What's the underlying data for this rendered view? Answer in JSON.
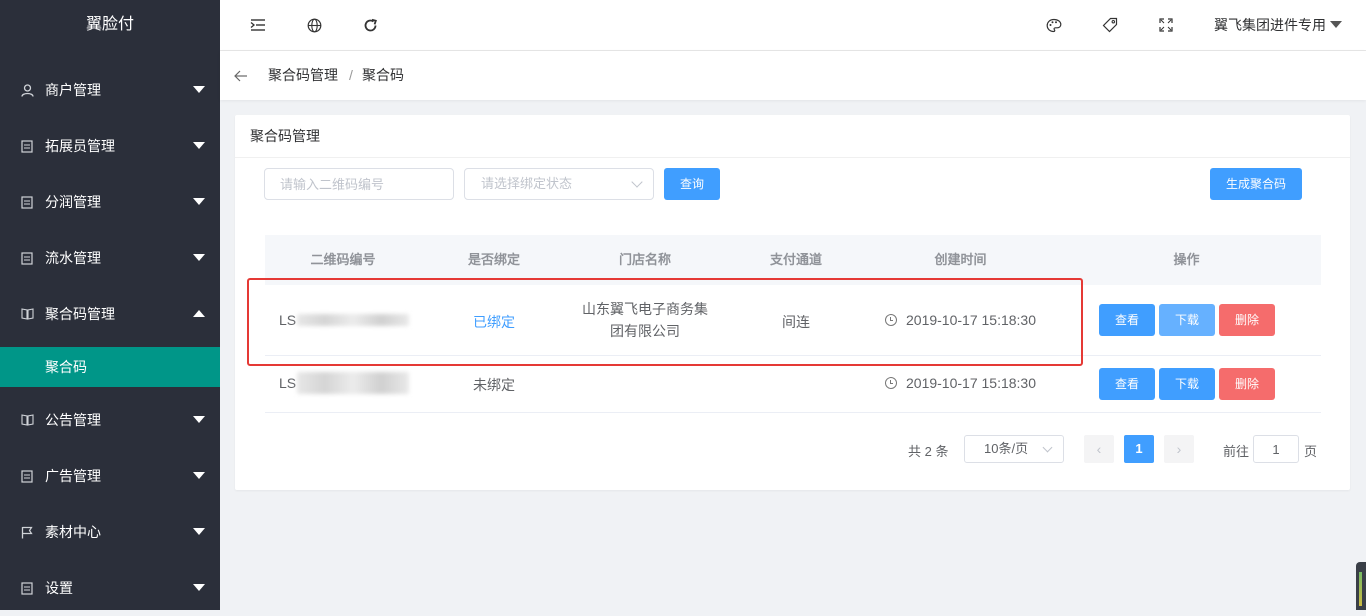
{
  "sidebar": {
    "brand": "翼脸付",
    "items": [
      {
        "label": "商户管理",
        "icon": "user-icon"
      },
      {
        "label": "拓展员管理",
        "icon": "doc-icon"
      },
      {
        "label": "分润管理",
        "icon": "doc-icon"
      },
      {
        "label": "流水管理",
        "icon": "doc-icon"
      },
      {
        "label": "聚合码管理",
        "icon": "book-icon",
        "expanded": true
      },
      {
        "label": "公告管理",
        "icon": "book-icon"
      },
      {
        "label": "广告管理",
        "icon": "doc-icon"
      },
      {
        "label": "素材中心",
        "icon": "flag-icon"
      },
      {
        "label": "设置",
        "icon": "doc-icon"
      }
    ],
    "subitem": "聚合码",
    "active_color": "#009688"
  },
  "topbar": {
    "icons": [
      "menu-fold-icon",
      "globe-icon",
      "refresh-icon",
      "palette-icon",
      "tag-icon",
      "fullscreen-icon"
    ],
    "user": "翼飞集团进件专用"
  },
  "breadcrumb": {
    "parent": "聚合码管理",
    "separator": "/",
    "current": "聚合码"
  },
  "card": {
    "title": "聚合码管理",
    "search_placeholder": "请输入二维码编号",
    "status_placeholder": "请选择绑定状态",
    "query_label": "查询",
    "generate_label": "生成聚合码"
  },
  "table": {
    "headers": [
      "二维码编号",
      "是否绑定",
      "门店名称",
      "支付通道",
      "创建时间",
      "操作"
    ],
    "rows": [
      {
        "code": "LS",
        "bound": "已绑定",
        "store_line1": "山东翼飞电子商务集",
        "store_line2": "团有限公司",
        "channel": "间连",
        "created": "2019-10-17 15:18:30"
      },
      {
        "code": "LS",
        "bound": "未绑定",
        "store_line1": "",
        "store_line2": "",
        "channel": "",
        "created": "2019-10-17 15:18:30"
      }
    ],
    "actions": {
      "view": "查看",
      "download": "下载",
      "delete": "删除"
    }
  },
  "pagination": {
    "total": "共 2 条",
    "page_size": "10条/页",
    "prev": "‹",
    "current": "1",
    "next": "›",
    "goto_label": "前往",
    "goto_value": "1",
    "page_unit": "页"
  },
  "colors": {
    "primary": "#409eff",
    "danger": "#f56c6c",
    "highlight": "#e53935",
    "sidebar_bg": "#2b2f3a"
  }
}
